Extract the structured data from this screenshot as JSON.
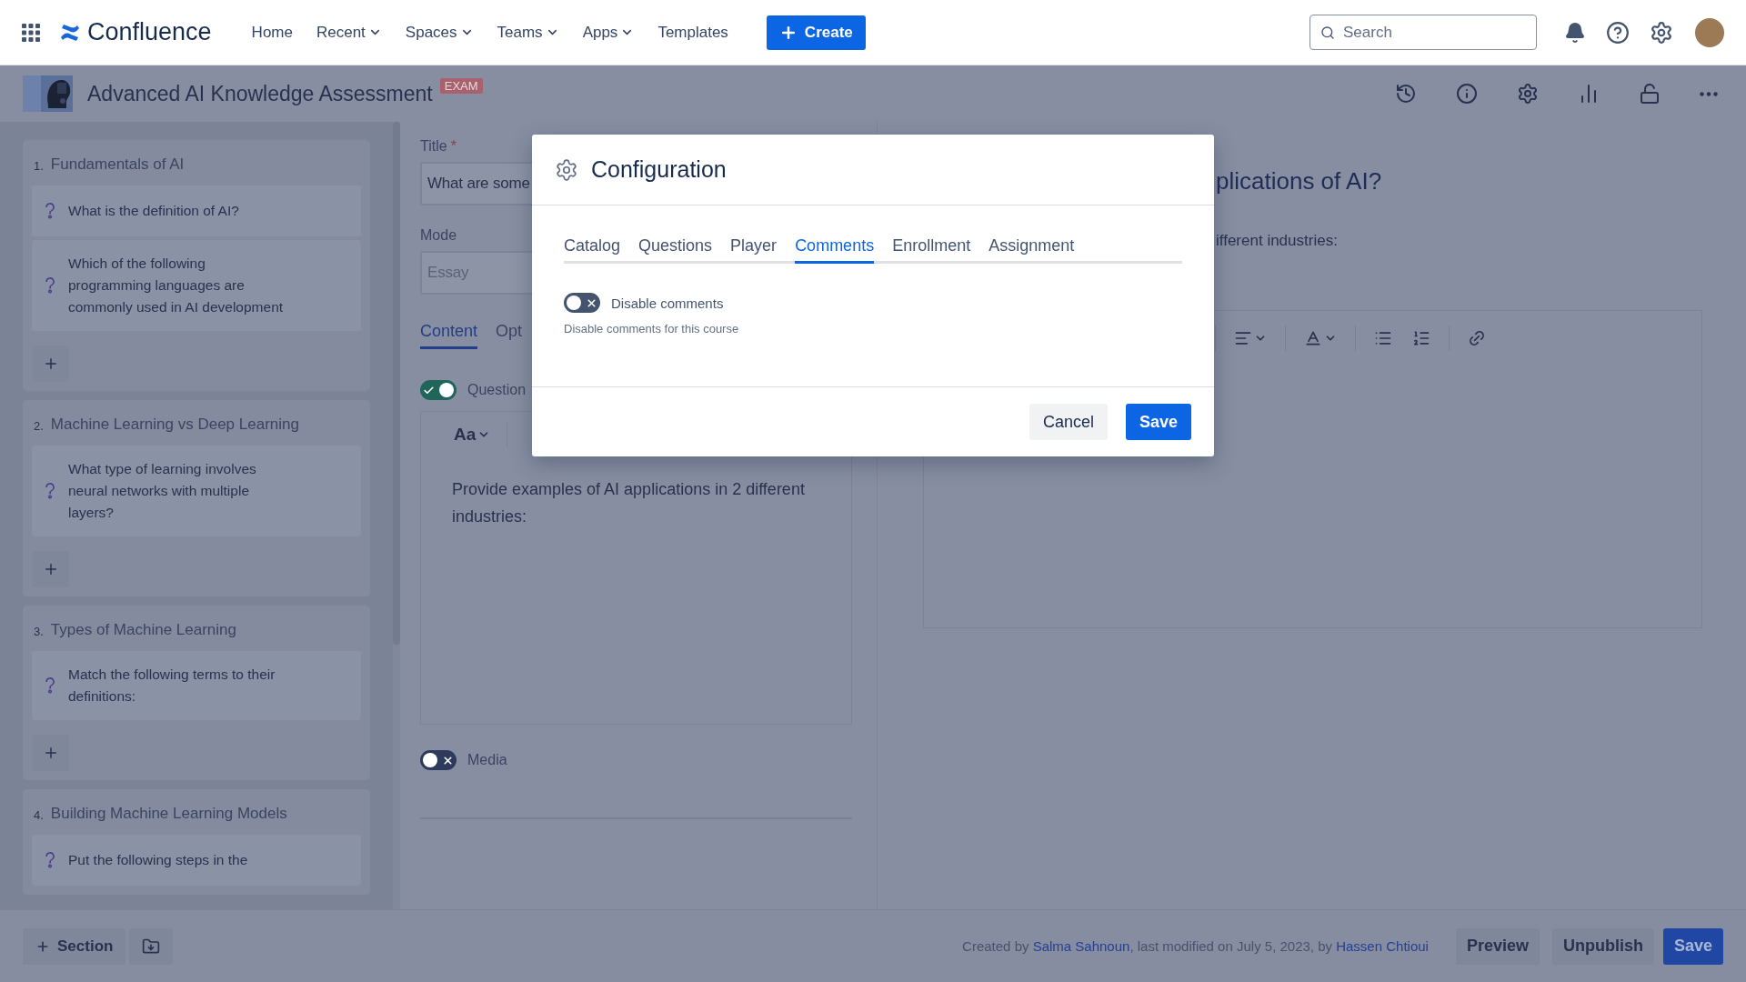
{
  "top_nav": {
    "product": "Confluence",
    "items": [
      {
        "label": "Home",
        "dropdown": false
      },
      {
        "label": "Recent",
        "dropdown": true
      },
      {
        "label": "Spaces",
        "dropdown": true
      },
      {
        "label": "Teams",
        "dropdown": true
      },
      {
        "label": "Apps",
        "dropdown": true
      },
      {
        "label": "Templates",
        "dropdown": false
      }
    ],
    "create": "Create",
    "search": {
      "placeholder": "Search"
    }
  },
  "page_header": {
    "title": "Advanced AI Knowledge Assessment",
    "badge": "EXAM"
  },
  "sections": [
    {
      "number": "1.",
      "title": "Fundamentals of AI",
      "questions": [
        "What is the definition of AI?",
        "Which of the following programming languages are commonly used in AI development"
      ]
    },
    {
      "number": "2.",
      "title": "Machine Learning vs Deep Learning",
      "questions": [
        "What type of learning involves neural networks with multiple layers?"
      ]
    },
    {
      "number": "3.",
      "title": "Types of Machine Learning",
      "questions": [
        "Match the following terms to their definitions:"
      ]
    },
    {
      "number": "4.",
      "title": "Building Machine Learning Models",
      "questions": [
        "Put the following steps in the"
      ]
    }
  ],
  "editor": {
    "title_label": "Title",
    "required_mark": "*",
    "title_value": "What are some",
    "mode_label": "Mode",
    "mode_placeholder": "Essay",
    "tabs": [
      {
        "label": "Content",
        "selected": true
      },
      {
        "label": "Opt",
        "selected": false
      }
    ],
    "question_toggle": {
      "label": "Question",
      "on": true
    },
    "toolbar_label": "Aa",
    "body": "Provide examples of AI applications in 2 different industries:",
    "media_toggle": {
      "label": "Media",
      "on": false
    }
  },
  "preview": {
    "heading": "plications of AI?",
    "text": "ifferent industries:"
  },
  "modal": {
    "title": "Configuration",
    "tabs": [
      {
        "label": "Catalog",
        "selected": false
      },
      {
        "label": "Questions",
        "selected": false
      },
      {
        "label": "Player",
        "selected": false
      },
      {
        "label": "Comments",
        "selected": true
      },
      {
        "label": "Enrollment",
        "selected": false
      },
      {
        "label": "Assignment",
        "selected": false
      }
    ],
    "setting": {
      "label": "Disable comments",
      "on": false,
      "hint": "Disable comments for this course"
    },
    "cancel": "Cancel",
    "save": "Save"
  },
  "footer": {
    "add_section": "Section",
    "credit": {
      "prefix": "Created by ",
      "author": "Salma Sahnoun",
      "middle": ", last modified on July 5, 2023, by ",
      "editor": "Hassen Chtioui"
    },
    "buttons": [
      {
        "label": "Preview",
        "kind": "secondary"
      },
      {
        "label": "Unpublish",
        "kind": "secondary"
      },
      {
        "label": "Save",
        "kind": "primary"
      }
    ]
  }
}
